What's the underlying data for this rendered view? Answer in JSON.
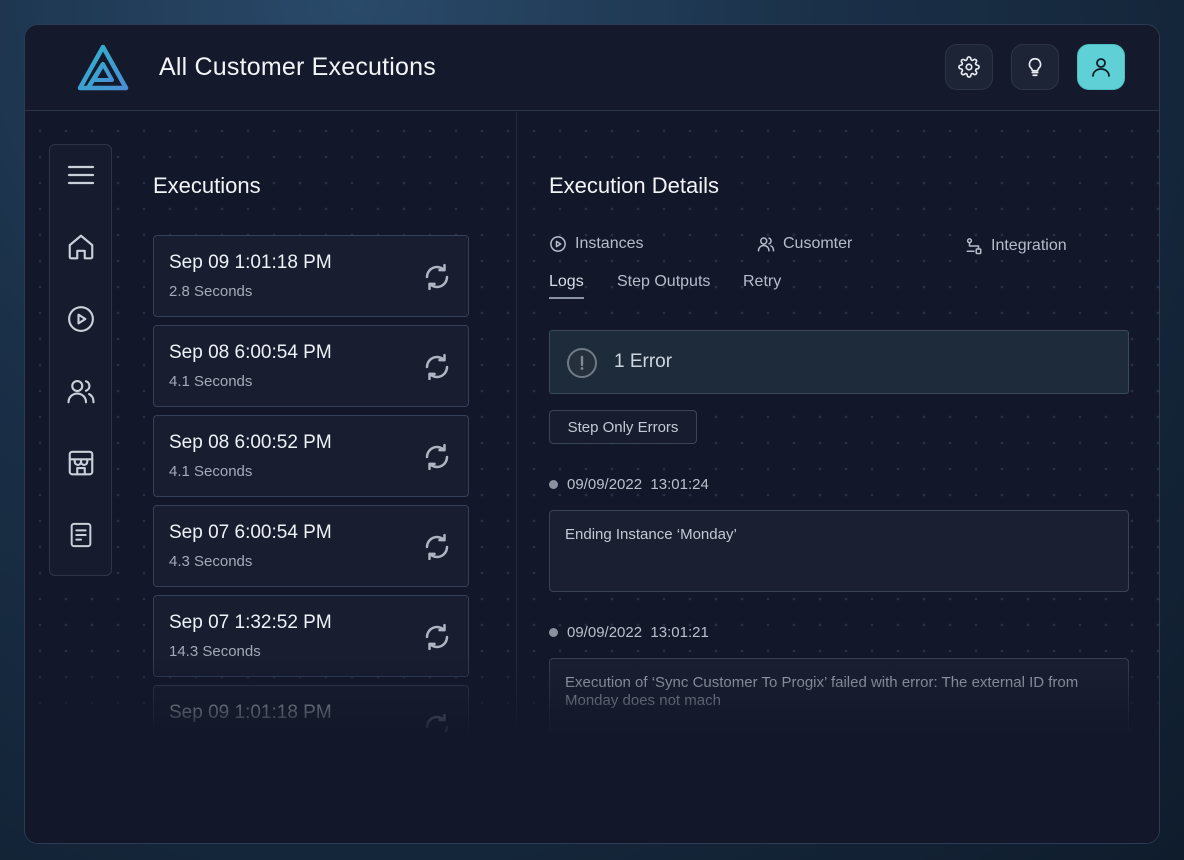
{
  "header": {
    "title": "All Customer Executions",
    "buttons": [
      {
        "icon": "gear-icon"
      },
      {
        "icon": "lightbulb-icon"
      },
      {
        "icon": "user-icon"
      }
    ]
  },
  "sidebar": {
    "items": [
      {
        "icon": "hamburger-menu-icon"
      },
      {
        "icon": "home-icon"
      },
      {
        "icon": "play-circle-icon"
      },
      {
        "icon": "users-icon"
      },
      {
        "icon": "store-icon"
      },
      {
        "icon": "document-icon"
      }
    ]
  },
  "executions": {
    "title": "Executions",
    "items": [
      {
        "date": "Sep 09 1:01:18 PM",
        "duration": "2.8 Seconds"
      },
      {
        "date": "Sep 08 6:00:54 PM",
        "duration": "4.1 Seconds"
      },
      {
        "date": "Sep 08 6:00:52 PM",
        "duration": "4.1 Seconds"
      },
      {
        "date": "Sep 07 6:00:54 PM",
        "duration": "4.3 Seconds"
      },
      {
        "date": "Sep 07 1:32:52 PM",
        "duration": "14.3 Seconds"
      },
      {
        "date": "Sep 09 1:01:18 PM",
        "duration": ""
      }
    ]
  },
  "details": {
    "title": "Execution Details",
    "info_tabs": [
      {
        "label": "Instances",
        "icon": "play-circle-icon"
      },
      {
        "label": "Cusomter",
        "icon": "users-icon"
      },
      {
        "label": "Integration",
        "icon": "integration-icon"
      }
    ],
    "sub_tabs": [
      {
        "label": "Logs",
        "active": true
      },
      {
        "label": "Step Outputs",
        "active": false
      },
      {
        "label": "Retry",
        "active": false
      }
    ],
    "error_banner": {
      "text": "1 Error",
      "icon": "alert-icon"
    },
    "filter_button": "Step Only Errors",
    "logs": [
      {
        "timestamp": "09/09/2022  13:01:24",
        "message": "Ending Instance ‘Monday’"
      },
      {
        "timestamp": "09/09/2022  13:01:21",
        "message": "Execution of ‘Sync Customer To Progix’ failed with error: The external ID from Monday does not mach"
      }
    ]
  },
  "colors": {
    "accent": "#5fd1d6",
    "background": "#12172a",
    "card": "#181e30",
    "text": "#f2f4f8"
  }
}
